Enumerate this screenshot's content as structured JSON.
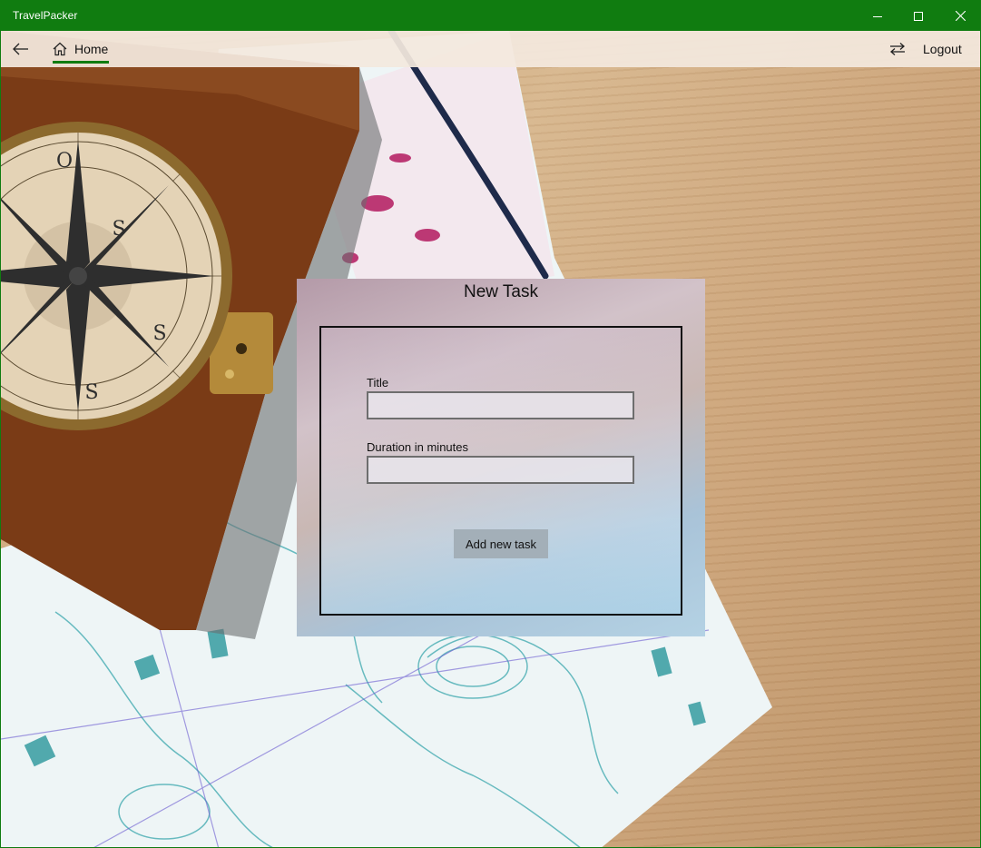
{
  "window": {
    "app_title": "TravelPacker",
    "accent_color": "#107c10"
  },
  "navbar": {
    "back_icon": "back-arrow-icon",
    "home_icon": "home-icon",
    "home_label": "Home",
    "swap_icon": "switch-arrows-icon",
    "logout_label": "Logout"
  },
  "dialog": {
    "title": "New Task",
    "fields": {
      "title_label": "Title",
      "title_value": "",
      "duration_label": "Duration in minutes",
      "duration_value": ""
    },
    "submit_label": "Add new task"
  }
}
